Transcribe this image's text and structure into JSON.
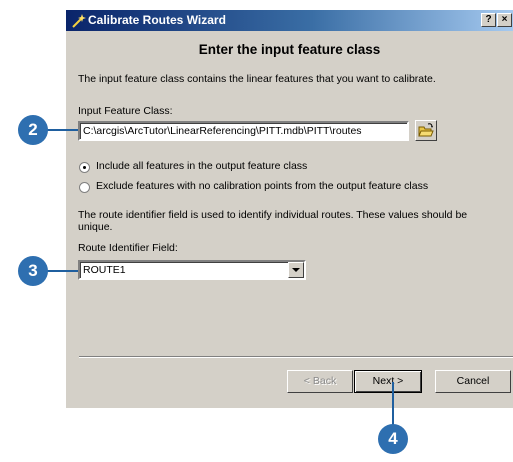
{
  "window": {
    "title": "Calibrate Routes Wizard",
    "help_button": "?",
    "close_button": "×"
  },
  "page": {
    "heading": "Enter the input feature class",
    "description": "The input feature class contains the linear features that you want to calibrate.",
    "input_label": "Input Feature Class:",
    "input_value": "C:\\arcgis\\ArcTutor\\LinearReferencing\\PITT.mdb\\PITT\\routes",
    "radio_include": "Include all features in the output feature class",
    "radio_exclude": "Exclude features with no calibration points from the output feature class",
    "route_description": "The route identifier field is used to identify individual routes.  These values should be unique.",
    "route_label": "Route Identifier Field:",
    "route_value": "ROUTE1"
  },
  "buttons": {
    "back": "< Back",
    "next": "Next >",
    "cancel": "Cancel"
  },
  "callouts": [
    "2",
    "3",
    "4"
  ],
  "colors": {
    "title_bar_start": "#0a246a",
    "title_bar_end": "#a6caf0",
    "dialog_face": "#d4d0c8",
    "callout": "#2e6fb0"
  },
  "icons": {
    "title": "wizard-wand-icon",
    "browse": "open-folder-icon",
    "dropdown": "chevron-down-icon"
  }
}
